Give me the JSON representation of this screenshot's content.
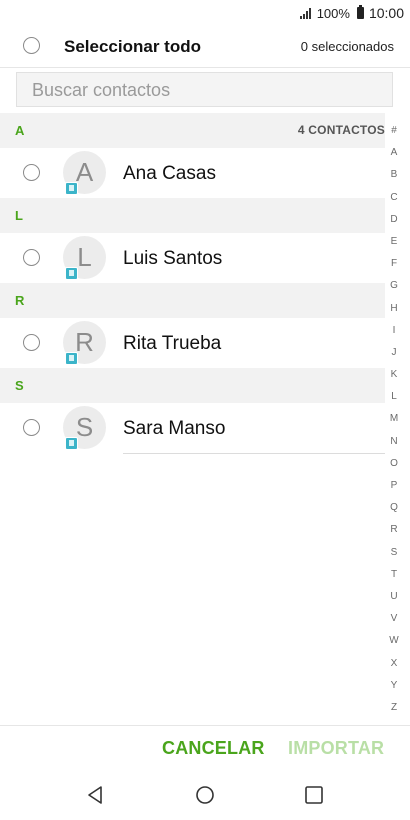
{
  "status_bar": {
    "battery": "100%",
    "time": "10:00"
  },
  "header": {
    "select_all": "Seleccionar todo",
    "selected_count": "0 seleccionados"
  },
  "search": {
    "placeholder": "Buscar contactos"
  },
  "sections": [
    {
      "letter": "A",
      "count": "4 CONTACTOS",
      "contacts": [
        {
          "initial": "A",
          "name": "Ana Casas"
        }
      ]
    },
    {
      "letter": "L",
      "contacts": [
        {
          "initial": "L",
          "name": "Luis Santos"
        }
      ]
    },
    {
      "letter": "R",
      "contacts": [
        {
          "initial": "R",
          "name": "Rita Trueba"
        }
      ]
    },
    {
      "letter": "S",
      "contacts": [
        {
          "initial": "S",
          "name": "Sara Manso"
        }
      ]
    }
  ],
  "index_letters": [
    "#",
    "A",
    "B",
    "C",
    "D",
    "E",
    "F",
    "G",
    "H",
    "I",
    "J",
    "K",
    "L",
    "M",
    "N",
    "O",
    "P",
    "Q",
    "R",
    "S",
    "T",
    "U",
    "V",
    "W",
    "X",
    "Y",
    "Z"
  ],
  "footer": {
    "cancel": "CANCELAR",
    "import": "IMPORTAR"
  },
  "colors": {
    "accent": "#4aa51c",
    "accent_disabled": "#b9dfa6",
    "badge": "#3bb4c9"
  },
  "icons": {
    "contact_source": "contact-card-icon",
    "back": "back-icon",
    "home": "home-icon",
    "recents": "recents-icon"
  }
}
